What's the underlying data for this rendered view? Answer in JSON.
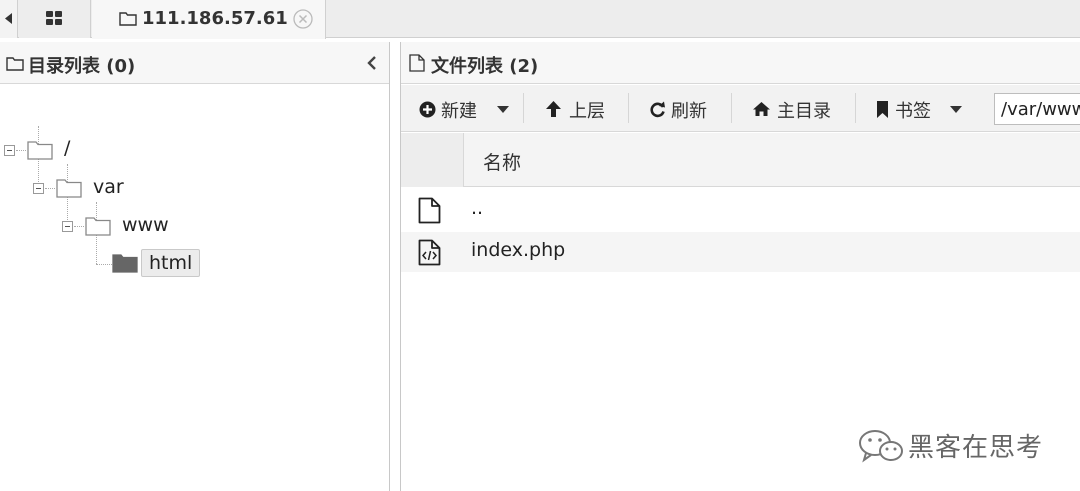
{
  "tabs": {
    "host_title": "111.186.57.61"
  },
  "left_panel": {
    "title": "目录列表 (0)",
    "tree": [
      {
        "label": "/"
      },
      {
        "label": "var"
      },
      {
        "label": "www"
      },
      {
        "label": "html",
        "selected": true
      }
    ]
  },
  "right_panel": {
    "title": "文件列表 (2)",
    "toolbar": {
      "new_label": "新建",
      "up_label": "上层",
      "refresh_label": "刷新",
      "home_label": "主目录",
      "bookmark_label": "书签",
      "path_value": "/var/www/html/"
    },
    "columns": {
      "name": "名称"
    },
    "files": [
      {
        "name": "..",
        "icon": "file-icon"
      },
      {
        "name": "index.php",
        "icon": "code-file-icon"
      }
    ]
  },
  "watermark": {
    "text": "黑客在思考"
  }
}
